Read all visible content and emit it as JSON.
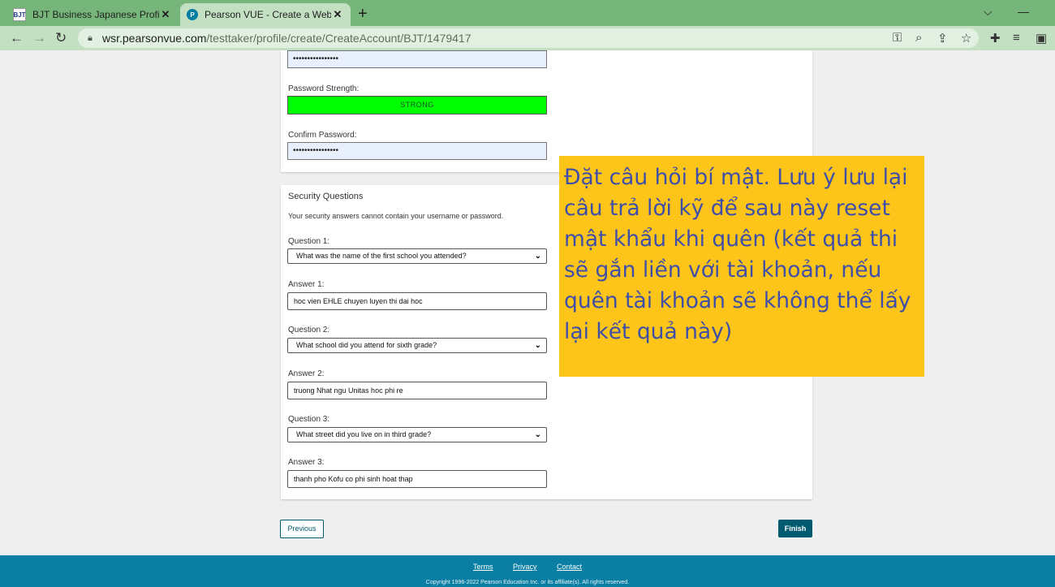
{
  "browser": {
    "tabs": [
      {
        "icon": "BJT",
        "title": "BJT Business Japanese Proficienc"
      },
      {
        "icon": "P",
        "title": "Pearson VUE - Create a Web Acc"
      }
    ],
    "close_glyph": "✕",
    "url_host": "wsr.pearsonvue.com",
    "url_path": "/testtaker/profile/create/CreateAccount/BJT/1479417"
  },
  "form": {
    "password_value": "••••••••••••••••",
    "strength_label": "Password Strength:",
    "strength_value": "STRONG",
    "confirm_label": "Confirm Password:",
    "confirm_value": "••••••••••••••••",
    "security": {
      "title": "Security Questions",
      "note": "Your security answers cannot contain your username or password.",
      "items": [
        {
          "q_label": "Question 1:",
          "question": "What was the name of the first school you attended?",
          "a_label": "Answer 1:",
          "answer": "hoc vien EHLE chuyen luyen thi dai hoc"
        },
        {
          "q_label": "Question 2:",
          "question": "What school did you attend for sixth grade?",
          "a_label": "Answer 2:",
          "answer": "truong Nhat ngu Unitas hoc phi re"
        },
        {
          "q_label": "Question 3:",
          "question": "What street did you live on in third grade?",
          "a_label": "Answer 3:",
          "answer": "thanh pho Kofu co phi sinh hoat thap"
        }
      ]
    },
    "previous_label": "Previous",
    "finish_label": "Finish"
  },
  "footer": {
    "links": [
      "Terms",
      "Privacy",
      "Contact"
    ],
    "copyright": "Copyright 1996-2022 Pearson Education Inc. or its affiliate(s). All rights reserved."
  },
  "annotation": {
    "text": "Đặt câu hỏi bí mật. Lưu ý lưu lại câu trả lời kỹ để sau này reset mật khẩu khi quên (kết quả thi sẽ gắn liền với tài khoản, nếu quên tài khoản sẽ không thể lấy lại kết quả này)"
  },
  "colors": {
    "tabbar": "#77b67b",
    "strength": "#00ff00",
    "pearson_teal": "#005a70",
    "footer": "#0a7fa3",
    "annotation_bg": "#fdc51a",
    "annotation_text": "#3f4fa8"
  }
}
